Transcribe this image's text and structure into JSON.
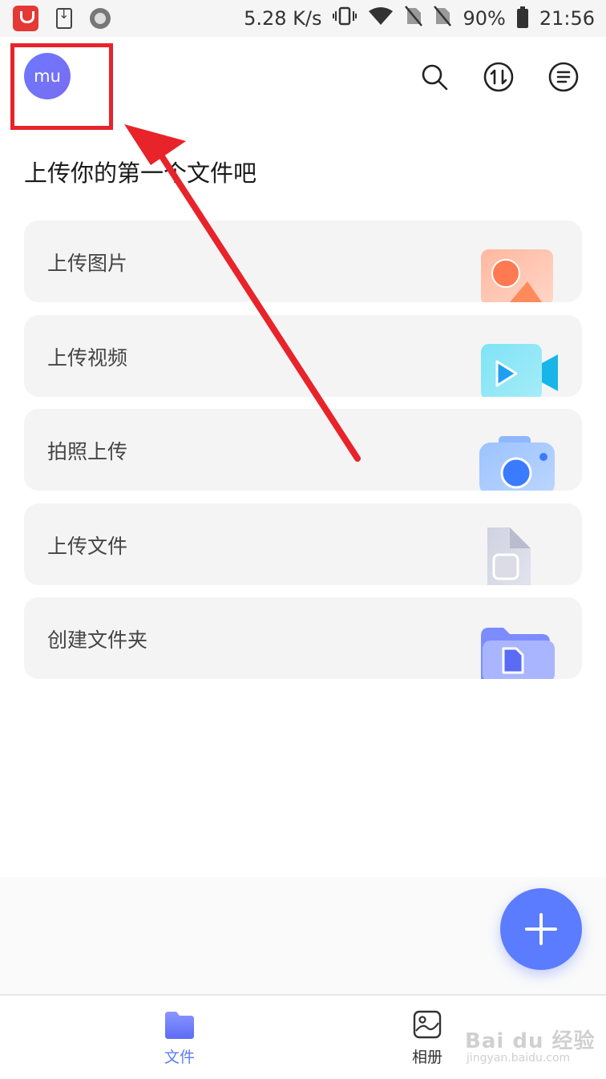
{
  "status_bar": {
    "net_speed": "5.28 K/s",
    "battery": "90%",
    "time": "21:56"
  },
  "header": {
    "avatar_text": "mu",
    "icons": [
      "search-icon",
      "transfer-icon",
      "menu-icon"
    ]
  },
  "main": {
    "title": "上传你的第一个文件吧",
    "actions": [
      {
        "label": "上传图片",
        "icon": "image-icon"
      },
      {
        "label": "上传视频",
        "icon": "video-icon"
      },
      {
        "label": "拍照上传",
        "icon": "camera-icon"
      },
      {
        "label": "上传文件",
        "icon": "file-icon"
      },
      {
        "label": "创建文件夹",
        "icon": "folder-icon"
      }
    ]
  },
  "fab": {
    "icon": "plus-icon"
  },
  "bottom_nav": {
    "items": [
      {
        "label": "文件",
        "icon": "folder-tab-icon",
        "active": true
      },
      {
        "label": "相册",
        "icon": "album-tab-icon",
        "active": false
      }
    ]
  },
  "watermark": {
    "brand": "Bai du 经验",
    "url": "jingyan.baidu.com"
  },
  "colors": {
    "accent": "#5b7cff",
    "annotation": "#e8232a",
    "card_bg": "#f4f4f5",
    "active_tab": "#5b7cff",
    "inactive_tab": "#333333"
  }
}
